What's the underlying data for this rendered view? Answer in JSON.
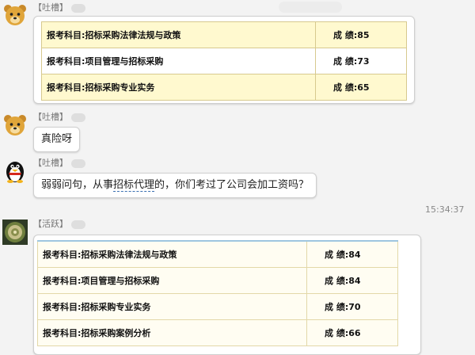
{
  "messages": [
    {
      "sender_tag": "【吐槽】",
      "avatar": "bear-icon",
      "rows": [
        {
          "subject": "报考科目:招标采购法律法规与政策",
          "score": "成  绩:85"
        },
        {
          "subject": "报考科目:项目管理与招标采购",
          "score": "成  绩:73"
        },
        {
          "subject": "报考科目:招标采购专业实务",
          "score": "成  绩:65"
        }
      ]
    },
    {
      "sender_tag": "【吐槽】",
      "avatar": "bear-icon",
      "text": "真险呀"
    },
    {
      "sender_tag": "【吐槽】",
      "avatar": "penguin-icon",
      "text_before": "弱弱问句，从事",
      "text_link": "招标代理",
      "text_after": "的，你们考过了公司会加工资吗？"
    },
    {
      "timestamp": "15:34:37"
    },
    {
      "sender_tag": "【活跃】",
      "avatar": "swirl-photo-icon",
      "rows": [
        {
          "subject": "报考科目:招标采购法律法规与政策",
          "score": "成  绩:84"
        },
        {
          "subject": "报考科目:项目管理与招标采购",
          "score": "成  绩:84"
        },
        {
          "subject": "报考科目:招标采购专业实务",
          "score": "成  绩:70"
        },
        {
          "subject": "报考科目:招标采购案例分析",
          "score": "成  绩:66"
        }
      ]
    }
  ],
  "colors": {
    "table_yellow": "#fff9cf",
    "table_border": "#d7c98e",
    "link_blue": "#3a6fb0"
  }
}
